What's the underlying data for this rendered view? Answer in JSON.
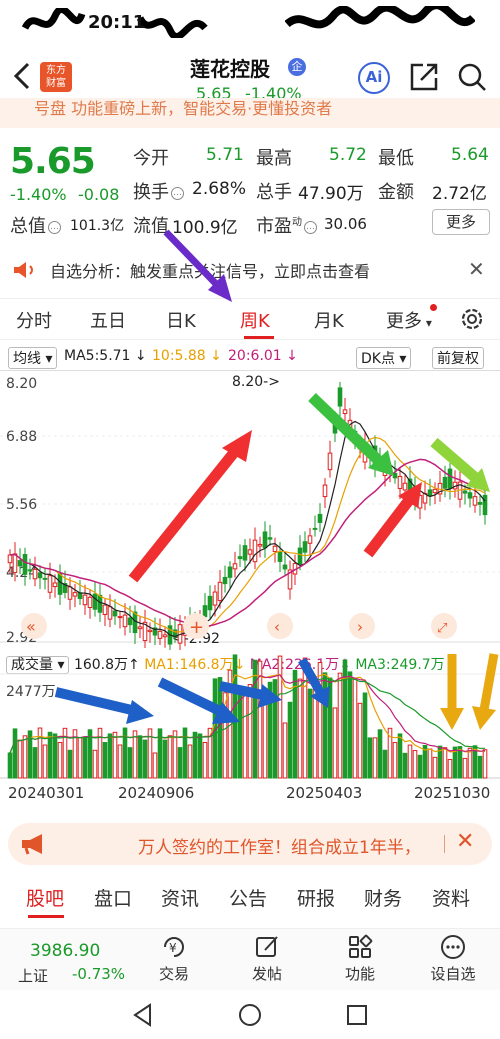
{
  "status": {
    "time": "20:11"
  },
  "header": {
    "logo_line1": "东方",
    "logo_line2": "财富",
    "stock_name": "莲花控股",
    "badge": "企",
    "price": "5.65",
    "change_pct": "-1.40%",
    "ai_label": "Ai"
  },
  "banner_strip": {
    "text": "号盘 功能重磅上新，智能交易·更懂投资者"
  },
  "quote": {
    "price": "5.65",
    "change_pct": "-1.40%",
    "change": "-0.08",
    "open_label": "今开",
    "open": "5.71",
    "high_label": "最高",
    "high": "5.72",
    "low_label": "最低",
    "low": "5.64",
    "turnover_label": "换手",
    "turnover": "2.68%",
    "volume_label": "总手",
    "volume": "47.90万",
    "amount_label": "金额",
    "amount": "2.72亿",
    "mktcap_label": "总值",
    "mktcap": "101.3亿",
    "float_label": "流值",
    "float_cap": "100.9亿",
    "pe_label": "市盈",
    "pe_sup": "动",
    "pe": "30.06",
    "more": "更多"
  },
  "analysis": {
    "text": "自选分析：触发重点关注信号，立即点击查看",
    "close": "✕"
  },
  "tabs": [
    "分时",
    "五日",
    "日K",
    "周K",
    "月K",
    "更多"
  ],
  "chart_toolbar": {
    "ma_mode": "均线",
    "ma5": "MA5:5.71",
    "ma10": "10:5.88",
    "ma20": "20:6.01",
    "dk": "DK点",
    "adjust": "前复权"
  },
  "kchart_labels": {
    "y_top": "8.20",
    "y_2": "6.88",
    "y_3": "5.56",
    "y_4": "4.24",
    "y_bottom": "2.92",
    "max_marker": "8.20->",
    "min_marker": "<-2.92"
  },
  "vol_toolbar": {
    "label": "成交量",
    "vol": "160.8万",
    "ma1": "MA1:146.8万",
    "ma2": "MA2:226.1万",
    "ma3": "MA3:249.7万",
    "y_top": "2477万"
  },
  "dates": [
    "20240301",
    "20240906",
    "20250403",
    "20251030"
  ],
  "promo": {
    "text": "万人签约的工作室！组合成立1年半，",
    "close": "✕"
  },
  "sections": [
    "股吧",
    "盘口",
    "资讯",
    "公告",
    "研报",
    "财务",
    "资料"
  ],
  "bottom_bar": {
    "index_value": "3986.90",
    "index_name": "上证",
    "index_change": "-0.73%",
    "buttons": [
      "交易",
      "发帖",
      "功能",
      "设自选"
    ]
  },
  "colors": {
    "up": "#e02020",
    "down": "#1a9a2a",
    "accent": "#e02020"
  }
}
